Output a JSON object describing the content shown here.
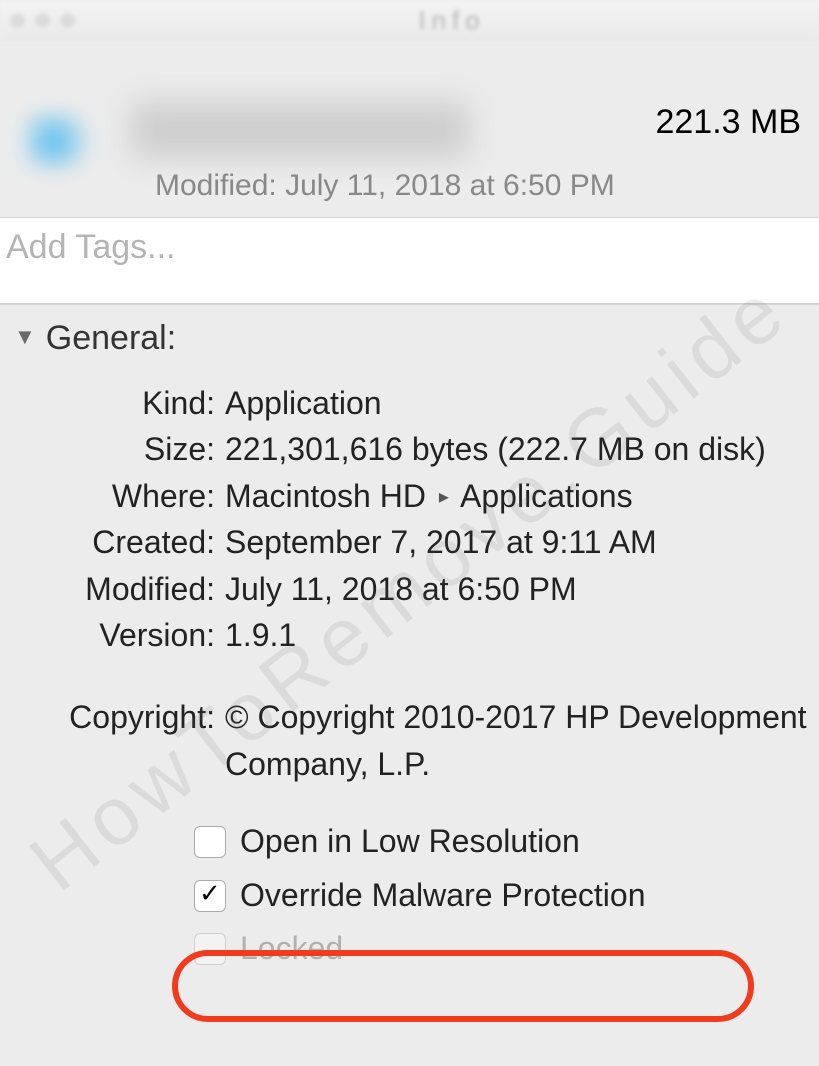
{
  "titlebar": {
    "title": "Info"
  },
  "header": {
    "size": "221.3 MB",
    "modified_prefix": "Modified:",
    "modified_value": "July 11, 2018 at 6:50 PM"
  },
  "tags": {
    "placeholder": "Add Tags..."
  },
  "general": {
    "heading": "General:",
    "kind_label": "Kind:",
    "kind_value": "Application",
    "size_label": "Size:",
    "size_value": "221,301,616 bytes (222.7 MB on disk)",
    "where_label": "Where:",
    "where_part1": "Macintosh HD",
    "where_part2": "Applications",
    "created_label": "Created:",
    "created_value": "September 7, 2017 at 9:11 AM",
    "modified_label": "Modified:",
    "modified_value": "July 11, 2018 at 6:50 PM",
    "version_label": "Version:",
    "version_value": "1.9.1",
    "copyright_label": "Copyright:",
    "copyright_value": "© Copyright 2010-2017 HP Development Company, L.P."
  },
  "checkboxes": {
    "low_res": "Open in Low Resolution",
    "override": "Override Malware Protection",
    "locked": "Locked"
  },
  "watermark": "HowToRemove.Guide"
}
